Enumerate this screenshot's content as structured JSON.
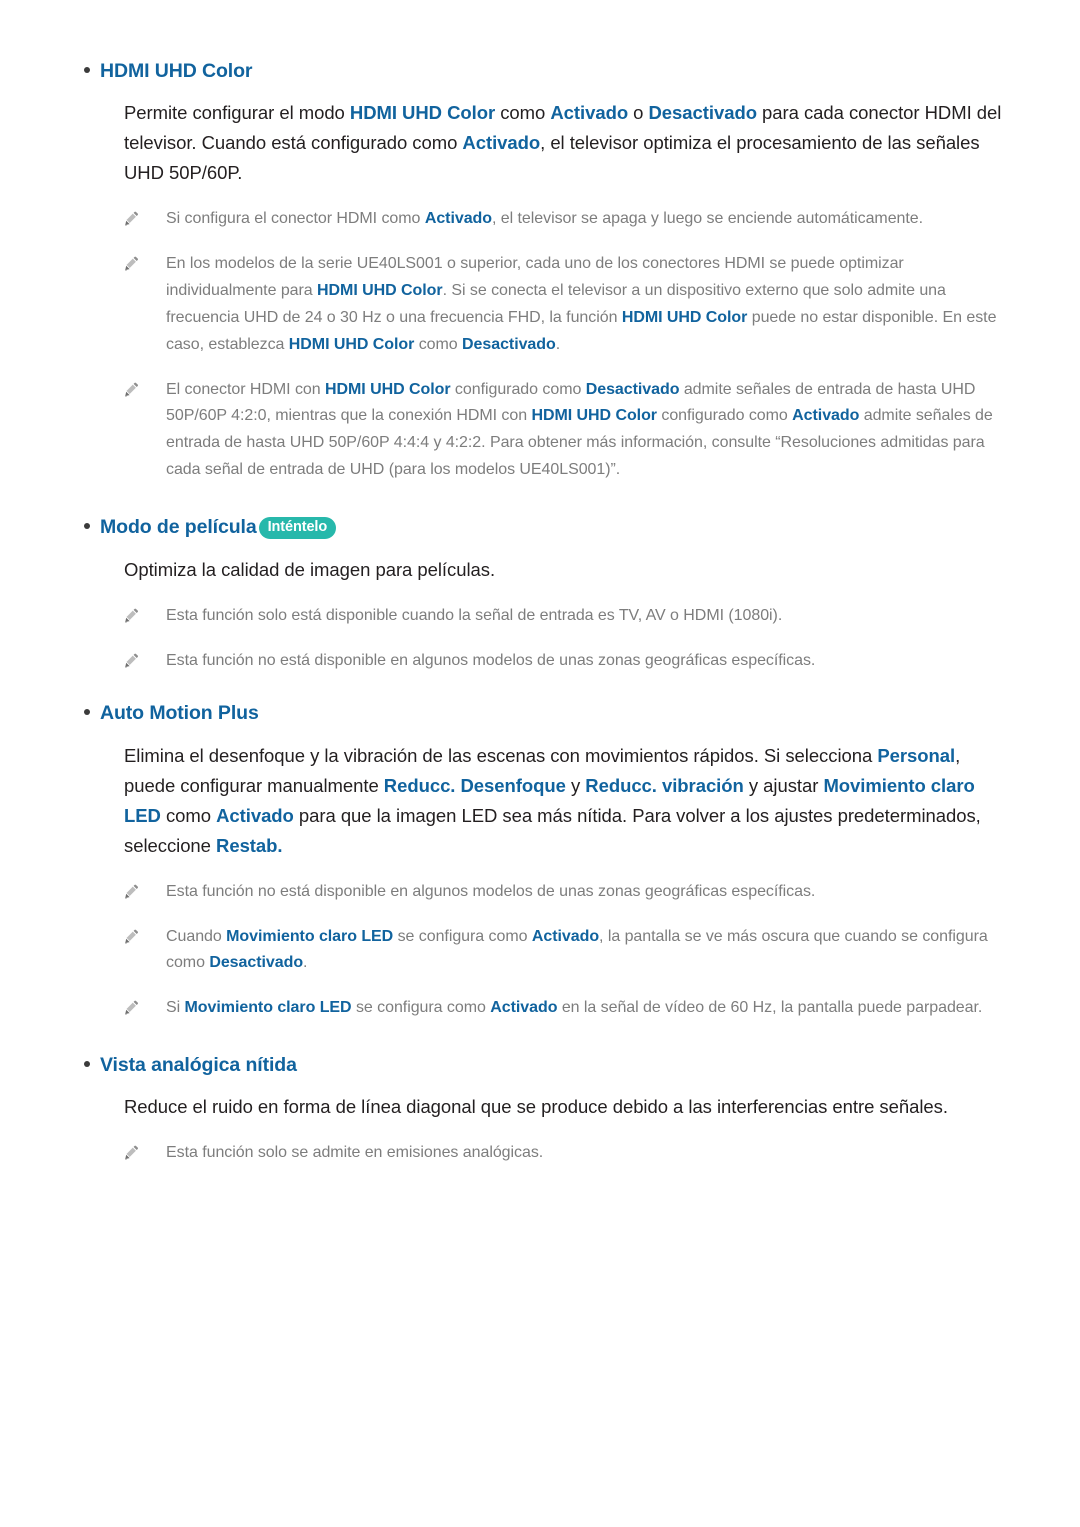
{
  "document": {
    "language": "es",
    "colors": {
      "heading_blue": "#11639e",
      "body_text": "#231f20",
      "note_text": "#7d7d7d",
      "badge_teal": "#27b8ab",
      "bullet": "#3b3b3b",
      "page_background": "#ffffff"
    }
  },
  "sections": [
    {
      "id": "hdmi-uhd-color",
      "heading": "HDMI UHD Color",
      "badge": null,
      "body": [
        {
          "t": "Permite configurar el modo ",
          "b": false
        },
        {
          "t": "HDMI UHD Color",
          "b": true
        },
        {
          "t": " como ",
          "b": false
        },
        {
          "t": "Activado",
          "b": true
        },
        {
          "t": " o ",
          "b": false
        },
        {
          "t": "Desactivado",
          "b": true
        },
        {
          "t": " para cada conector HDMI del televisor. Cuando está configurado como ",
          "b": false
        },
        {
          "t": "Activado",
          "b": true
        },
        {
          "t": ", el televisor optimiza el procesamiento de las señales UHD 50P/60P.",
          "b": false
        }
      ],
      "notes": [
        {
          "icon": "pencil-note-icon",
          "parts": [
            {
              "t": "Si configura el conector HDMI como ",
              "b": false
            },
            {
              "t": "Activado",
              "b": true
            },
            {
              "t": ", el televisor se apaga y luego se enciende automáticamente.",
              "b": false
            }
          ]
        },
        {
          "icon": "pencil-note-icon",
          "parts": [
            {
              "t": "En los modelos de la serie UE40LS001 o superior, cada uno de los conectores HDMI se puede optimizar individualmente para ",
              "b": false
            },
            {
              "t": "HDMI UHD Color",
              "b": true
            },
            {
              "t": ". Si se conecta el televisor a un dispositivo externo que solo admite una frecuencia UHD de 24 o 30 Hz o una frecuencia FHD, la función ",
              "b": false
            },
            {
              "t": "HDMI UHD Color",
              "b": true
            },
            {
              "t": " puede no estar disponible. En este caso, establezca ",
              "b": false
            },
            {
              "t": "HDMI UHD Color",
              "b": true
            },
            {
              "t": " como ",
              "b": false
            },
            {
              "t": "Desactivado",
              "b": true
            },
            {
              "t": ".",
              "b": false
            }
          ]
        },
        {
          "icon": "pencil-note-icon",
          "parts": [
            {
              "t": "El conector HDMI con ",
              "b": false
            },
            {
              "t": "HDMI UHD Color",
              "b": true
            },
            {
              "t": " configurado como ",
              "b": false
            },
            {
              "t": "Desactivado",
              "b": true
            },
            {
              "t": " admite señales de entrada de hasta UHD 50P/60P 4:2:0, mientras que la conexión HDMI con ",
              "b": false
            },
            {
              "t": "HDMI UHD Color",
              "b": true
            },
            {
              "t": " configurado como ",
              "b": false
            },
            {
              "t": "Activado",
              "b": true
            },
            {
              "t": " admite señales de entrada de hasta UHD 50P/60P 4:4:4 y 4:2:2. Para obtener más información, consulte “Resoluciones admitidas para cada señal de entrada de UHD (para los modelos UE40LS001)”.",
              "b": false
            }
          ]
        }
      ]
    },
    {
      "id": "modo-de-pelicula",
      "heading": "Modo de película",
      "badge": "Inténtelo",
      "body": [
        {
          "t": "Optimiza la calidad de imagen para películas.",
          "b": false
        }
      ],
      "notes": [
        {
          "icon": "pencil-note-icon",
          "parts": [
            {
              "t": "Esta función solo está disponible cuando la señal de entrada es TV, AV o HDMI (1080i).",
              "b": false
            }
          ]
        },
        {
          "icon": "pencil-note-icon",
          "parts": [
            {
              "t": "Esta función no está disponible en algunos modelos de unas zonas geográficas específicas.",
              "b": false
            }
          ]
        }
      ]
    },
    {
      "id": "auto-motion-plus",
      "heading": "Auto Motion Plus",
      "badge": null,
      "body": [
        {
          "t": "Elimina el desenfoque y la vibración de las escenas con movimientos rápidos. Si selecciona ",
          "b": false
        },
        {
          "t": "Personal",
          "b": true
        },
        {
          "t": ", puede configurar manualmente ",
          "b": false
        },
        {
          "t": "Reducc. Desenfoque",
          "b": true
        },
        {
          "t": " y ",
          "b": false
        },
        {
          "t": "Reducc. vibración",
          "b": true
        },
        {
          "t": " y ajustar ",
          "b": false
        },
        {
          "t": "Movimiento claro LED",
          "b": true
        },
        {
          "t": " como ",
          "b": false
        },
        {
          "t": "Activado",
          "b": true
        },
        {
          "t": " para que la imagen LED sea más nítida. Para volver a los ajustes predeterminados, seleccione ",
          "b": false
        },
        {
          "t": "Restab.",
          "b": true
        }
      ],
      "notes": [
        {
          "icon": "pencil-note-icon",
          "parts": [
            {
              "t": "Esta función no está disponible en algunos modelos de unas zonas geográficas específicas.",
              "b": false
            }
          ]
        },
        {
          "icon": "pencil-note-icon",
          "parts": [
            {
              "t": "Cuando ",
              "b": false
            },
            {
              "t": "Movimiento claro LED",
              "b": true
            },
            {
              "t": " se configura como ",
              "b": false
            },
            {
              "t": "Activado",
              "b": true
            },
            {
              "t": ", la pantalla se ve más oscura que cuando se configura como ",
              "b": false
            },
            {
              "t": "Desactivado",
              "b": true
            },
            {
              "t": ".",
              "b": false
            }
          ]
        },
        {
          "icon": "pencil-note-icon",
          "parts": [
            {
              "t": "Si ",
              "b": false
            },
            {
              "t": "Movimiento claro LED",
              "b": true
            },
            {
              "t": " se configura como ",
              "b": false
            },
            {
              "t": "Activado",
              "b": true
            },
            {
              "t": " en la señal de vídeo de 60 Hz, la pantalla puede parpadear.",
              "b": false
            }
          ]
        }
      ]
    },
    {
      "id": "vista-analogica-nitida",
      "heading": "Vista analógica nítida",
      "badge": null,
      "body": [
        {
          "t": "Reduce el ruido en forma de línea diagonal que se produce debido a las interferencias entre señales.",
          "b": false
        }
      ],
      "notes": [
        {
          "icon": "pencil-note-icon",
          "parts": [
            {
              "t": "Esta función solo se admite en emisiones analógicas.",
              "b": false
            }
          ]
        }
      ]
    }
  ]
}
